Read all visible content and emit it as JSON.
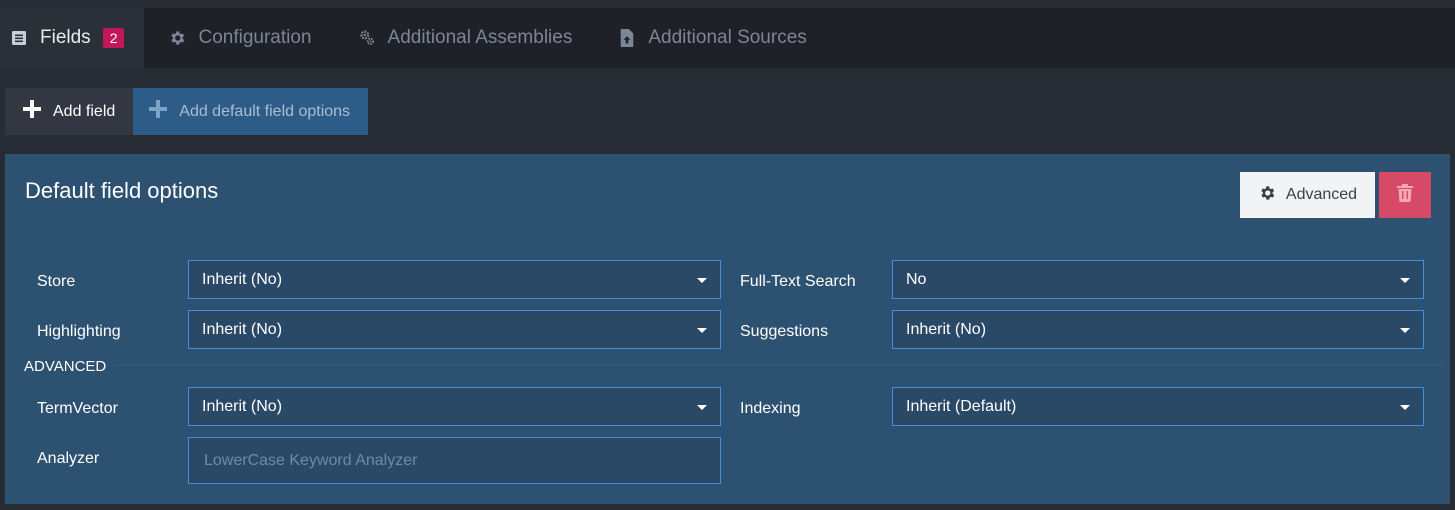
{
  "tabs": [
    {
      "label": "Fields",
      "badge": "2",
      "icon": "list-icon"
    },
    {
      "label": "Configuration",
      "icon": "gear-icon"
    },
    {
      "label": "Additional Assemblies",
      "icon": "gears-icon"
    },
    {
      "label": "Additional Sources",
      "icon": "file-upload-icon"
    }
  ],
  "actions": {
    "add_field": "Add field",
    "add_default": "Add default field options"
  },
  "panel": {
    "title": "Default field options",
    "advanced_button": "Advanced",
    "section_advanced": "ADVANCED",
    "fields": {
      "store": {
        "label": "Store",
        "value": "Inherit (No)"
      },
      "full_text_search": {
        "label": "Full-Text Search",
        "value": "No"
      },
      "highlighting": {
        "label": "Highlighting",
        "value": "Inherit (No)"
      },
      "suggestions": {
        "label": "Suggestions",
        "value": "Inherit (No)"
      },
      "term_vector": {
        "label": "TermVector",
        "value": "Inherit (No)"
      },
      "indexing": {
        "label": "Indexing",
        "value": "Inherit (Default)"
      },
      "analyzer": {
        "label": "Analyzer",
        "placeholder": "LowerCase Keyword Analyzer"
      }
    }
  },
  "colors": {
    "tab_badge": "#c2185b",
    "panel_bg": "#2d5170",
    "delete_button": "#d64a67",
    "add_default_button": "#2d5c88"
  }
}
